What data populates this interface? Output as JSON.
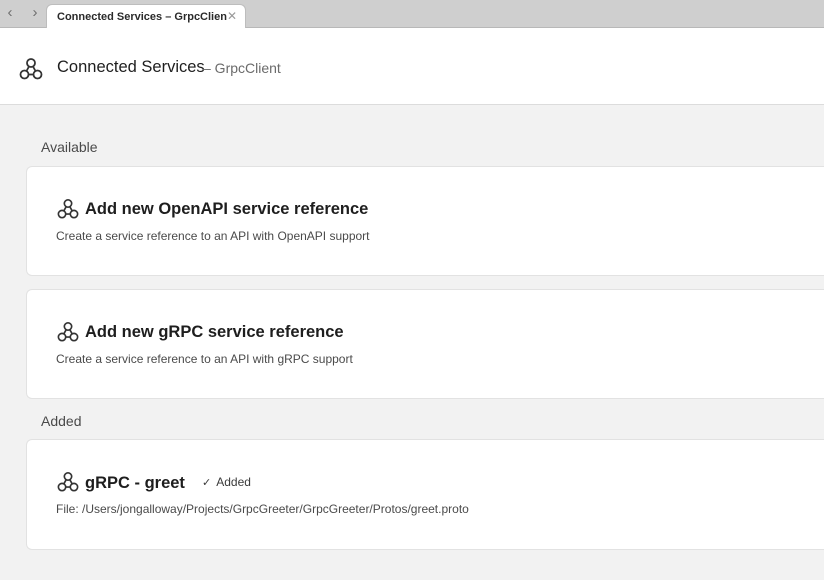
{
  "tab": {
    "title": "Connected Services – GrpcClient",
    "back_icon": "chevron-left-icon",
    "forward_icon": "chevron-right-icon",
    "close_icon": "close-icon"
  },
  "header": {
    "icon": "connected-services-icon",
    "title": "Connected Services",
    "subtitle": "– GrpcClient"
  },
  "sections": {
    "available": {
      "label": "Available",
      "items": [
        {
          "icon": "connected-services-icon",
          "title": "Add new OpenAPI service reference",
          "description": "Create a service reference to an API with OpenAPI support"
        },
        {
          "icon": "connected-services-icon",
          "title": "Add new gRPC service reference",
          "description": "Create a service reference to an API with gRPC support"
        }
      ]
    },
    "added": {
      "label": "Added",
      "items": [
        {
          "icon": "connected-services-icon",
          "title": "gRPC - greet",
          "status_icon": "checkmark-icon",
          "status": "Added",
          "description": "File: /Users/jongalloway/Projects/GrpcGreeter/GrpcGreeter/Protos/greet.proto"
        }
      ]
    }
  }
}
